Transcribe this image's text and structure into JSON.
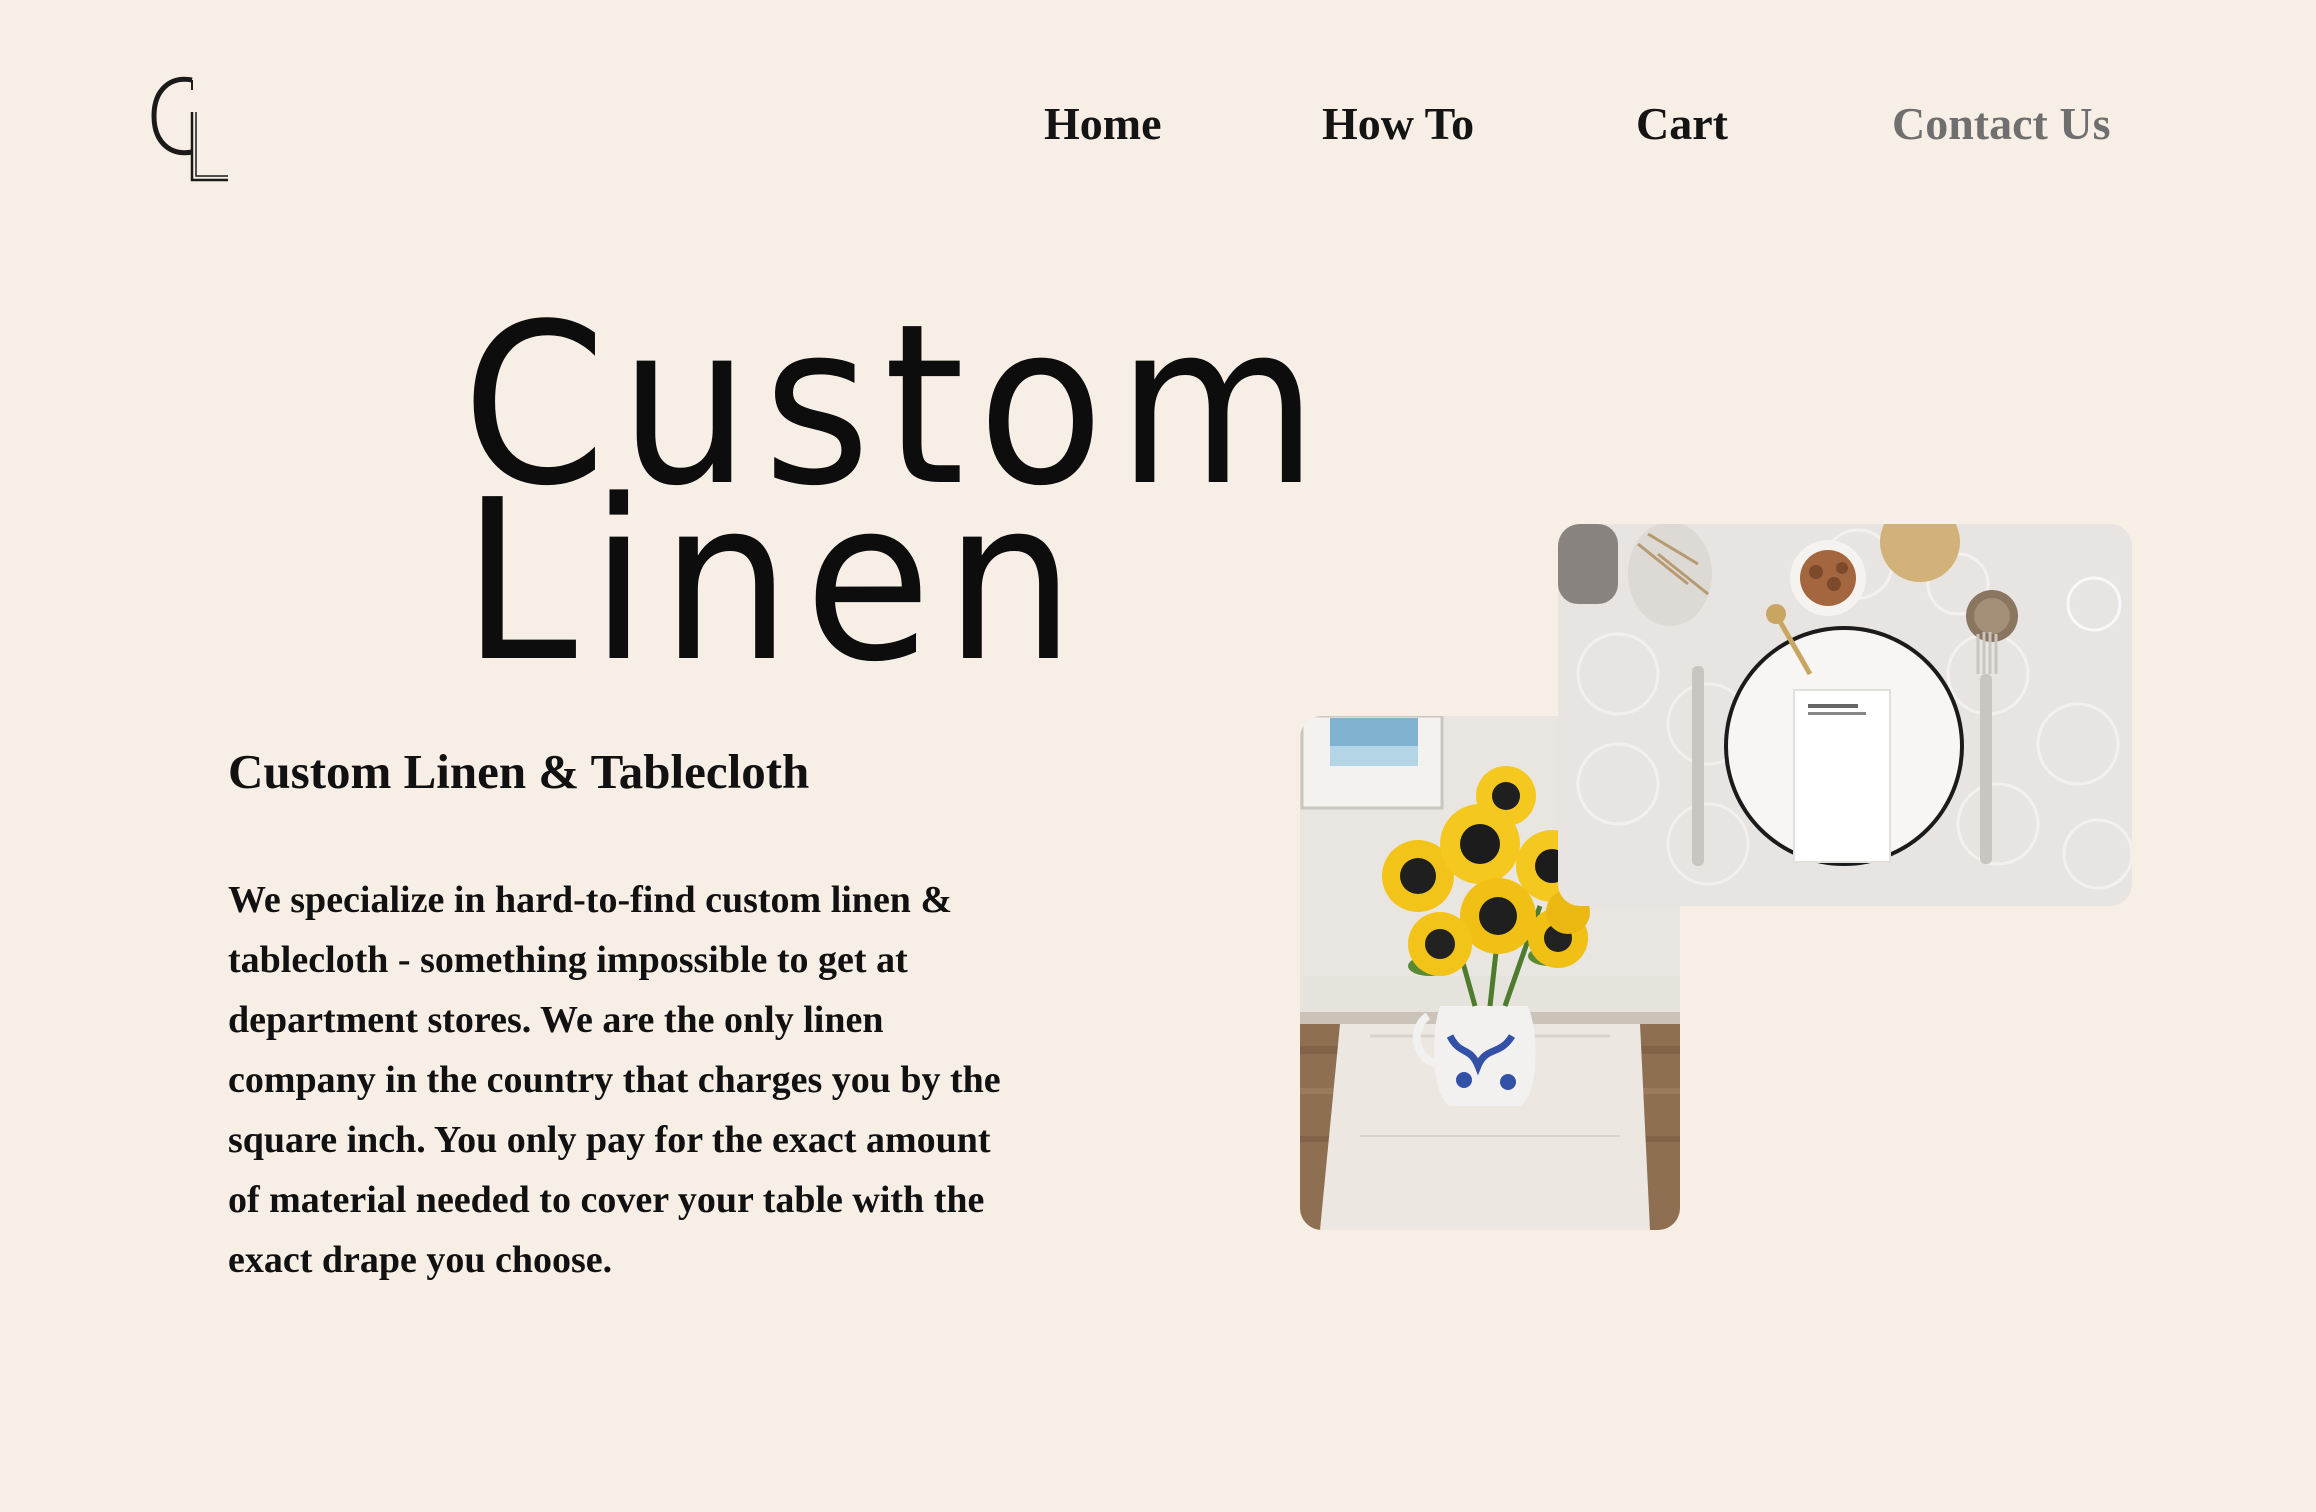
{
  "logo": {
    "letters": "CL"
  },
  "nav": {
    "items": [
      {
        "label": "Home"
      },
      {
        "label": "How To"
      },
      {
        "label": "Cart"
      },
      {
        "label": "Contact Us"
      }
    ],
    "active_color": "#6f6f6f"
  },
  "hero": {
    "title_line1": "Custom",
    "title_line2": "Linen",
    "subheading": "Custom Linen & Tablecloth",
    "body": "We specialize in hard-to-find custom linen & tablecloth - something impossible to get at department stores. We are the only linen company in the country that charges you by the square inch. You only pay for the exact amount of material needed to cover your table with the exact drape you choose."
  },
  "photos": [
    {
      "name": "sunflowers-vase-photo"
    },
    {
      "name": "table-setting-photo"
    }
  ],
  "colors": {
    "background": "#f7efe6",
    "text": "#111111"
  }
}
